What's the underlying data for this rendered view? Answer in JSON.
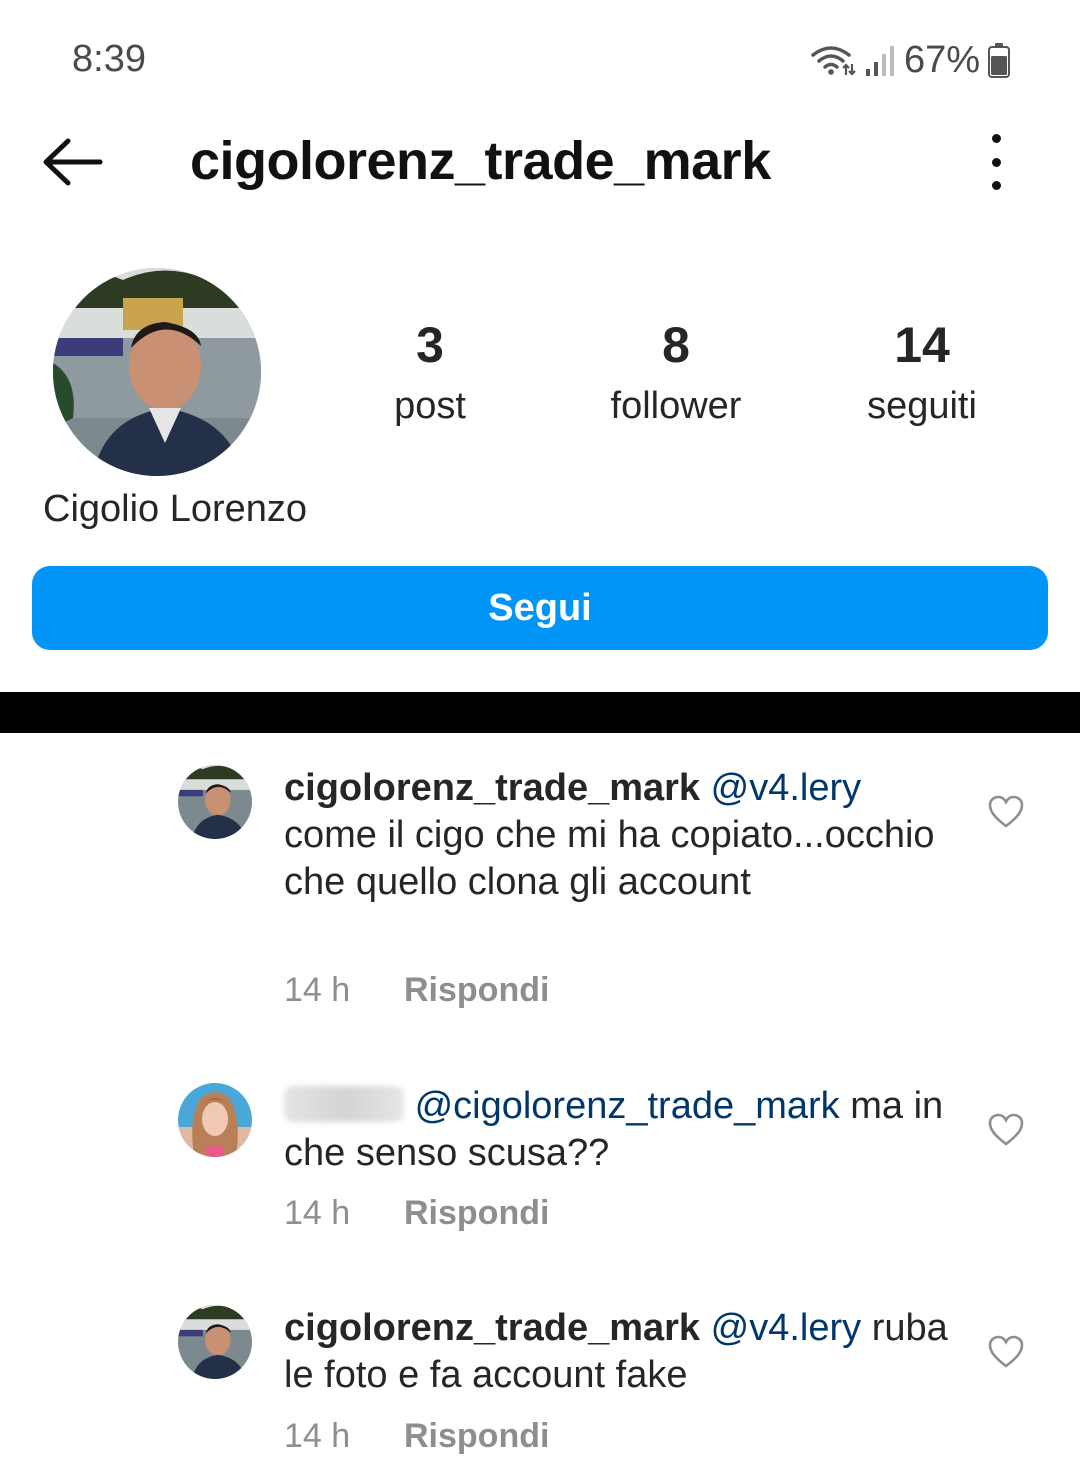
{
  "status_bar": {
    "time": "8:39",
    "battery_pct": "67%"
  },
  "header": {
    "username": "cigolorenz_trade_mark"
  },
  "profile": {
    "display_name": "Cigolio Lorenzo",
    "stats": {
      "posts": {
        "count": "3",
        "label": "post"
      },
      "followers": {
        "count": "8",
        "label": "follower"
      },
      "following": {
        "count": "14",
        "label": "seguiti"
      }
    },
    "follow_label": "Segui"
  },
  "comments": [
    {
      "user": "cigolorenz_trade_mark",
      "mention": "@v4.lery",
      "text": "come il cigo che mi ha copiato...occhio che quello clona gli account",
      "time": "14 h",
      "reply_label": "Rispondi"
    },
    {
      "user": "v4.lery",
      "mention": "@cigolorenz_trade_mark",
      "text": "ma in che senso scusa??",
      "time": "14 h",
      "reply_label": "Rispondi"
    },
    {
      "user": "cigolorenz_trade_mark",
      "mention": "@v4.lery",
      "text": "ruba le foto e fa account fake",
      "time": "14 h",
      "reply_label": "Rispondi"
    }
  ],
  "colors": {
    "accent": "#0095f6",
    "mention": "#00376b",
    "meta": "#8e8e8e",
    "text": "#262626"
  },
  "icons": [
    "wifi-icon",
    "signal-icon",
    "battery-icon",
    "back-arrow-icon",
    "more-options-icon",
    "heart-icon"
  ]
}
